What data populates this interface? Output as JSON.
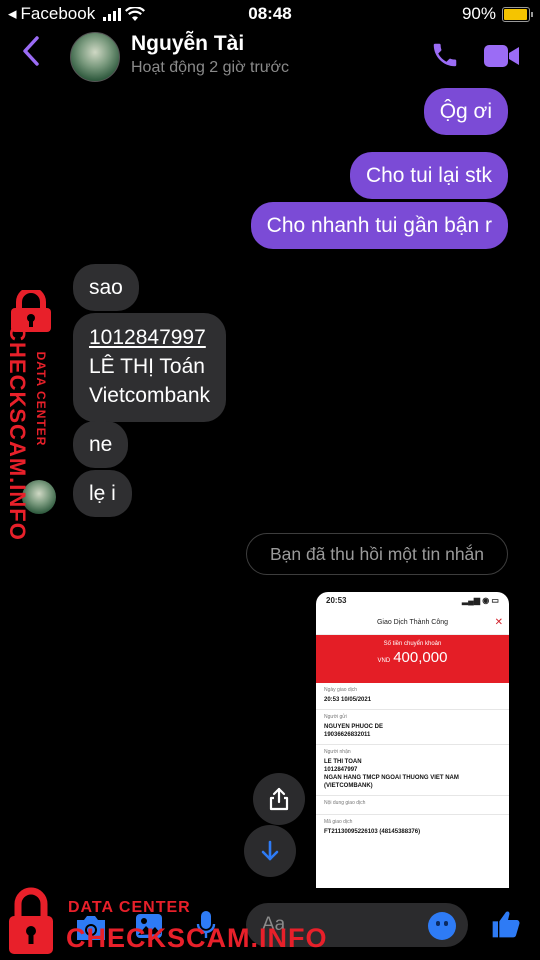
{
  "status_bar": {
    "back_app": "Facebook",
    "time": "08:48",
    "battery": "90%"
  },
  "header": {
    "name": "Nguyễn Tài",
    "status": "Hoạt động 2 giờ trước"
  },
  "messages": {
    "outgoing": [
      "Ộg ơi",
      "Cho tui lại stk",
      "Cho nhanh tui gần bận r"
    ],
    "incoming_1": "sao",
    "account": {
      "number": "1012847997",
      "name": "LÊ THỊ Toán",
      "bank": "Vietcombank"
    },
    "incoming_3": "ne",
    "incoming_4": "lẹ i",
    "recalled": "Bạn đã thu hồi một tin nhắn"
  },
  "receipt": {
    "time": "20:53",
    "title": "Giao Dịch Thành Công",
    "amount_label": "Số tiền chuyển khoản",
    "currency": "VND",
    "amount": "400,000",
    "rows": [
      {
        "label": "Ngày giao dịch",
        "value": "20:53 10/05/2021"
      },
      {
        "label": "Người gửi",
        "value": "NGUYEN PHUOC DE\n19036626832011"
      },
      {
        "label": "Người nhận",
        "value": "LE THI TOAN\n1012847997\nNGAN HANG TMCP NGOAI THUONG VIET NAM\n(VIETCOMBANK)"
      },
      {
        "label": "Nội dung giao dịch",
        "value": ""
      },
      {
        "label": "Mã giao dịch",
        "value": "FT21130095226103 (48145388376)"
      }
    ]
  },
  "composer": {
    "placeholder": "Aa"
  },
  "watermark": {
    "small": "DATA CENTER",
    "big": "CHECKSCAM.INFO"
  },
  "colors": {
    "outgoing_bubble": "#7b4bd6",
    "incoming_bubble": "#2f2f31",
    "accent": "#9b6cf5",
    "watermark": "#e8202a"
  }
}
